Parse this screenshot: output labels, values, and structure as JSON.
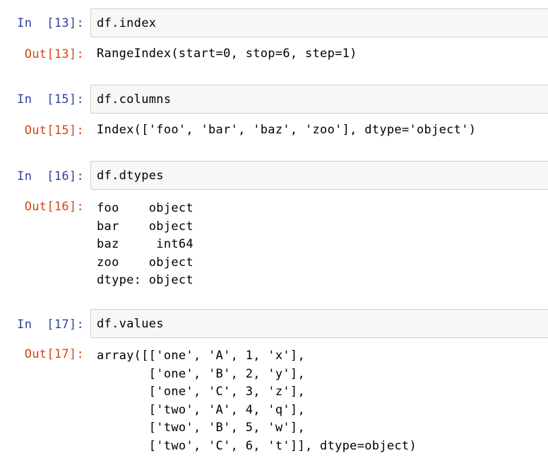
{
  "cells": [
    {
      "in_prompt": "In  [13]:",
      "code": "df.index",
      "out_prompt": "Out[13]:",
      "output": "RangeIndex(start=0, stop=6, step=1)"
    },
    {
      "in_prompt": "In  [15]:",
      "code": "df.columns",
      "out_prompt": "Out[15]:",
      "output": "Index(['foo', 'bar', 'baz', 'zoo'], dtype='object')"
    },
    {
      "in_prompt": "In  [16]:",
      "code": "df.dtypes",
      "out_prompt": "Out[16]:",
      "output": "foo    object\nbar    object\nbaz     int64\nzoo    object\ndtype: object"
    },
    {
      "in_prompt": "In  [17]:",
      "code": "df.values",
      "out_prompt": "Out[17]:",
      "output": "array([['one', 'A', 1, 'x'],\n       ['one', 'B', 2, 'y'],\n       ['one', 'C', 3, 'z'],\n       ['two', 'A', 4, 'q'],\n       ['two', 'B', 5, 'w'],\n       ['two', 'C', 6, 't']], dtype=object)"
    }
  ]
}
